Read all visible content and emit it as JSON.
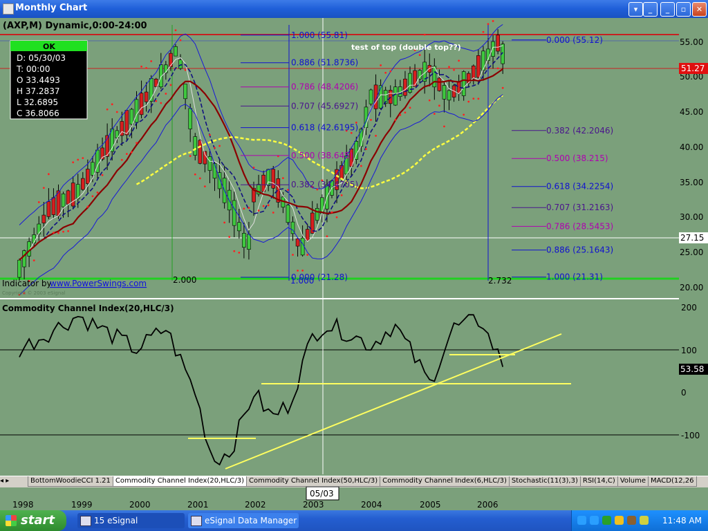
{
  "window": {
    "title": "Monthly Chart",
    "buttons": [
      "▾",
      "_",
      "▫",
      "✕"
    ]
  },
  "price_panel": {
    "symbol_label": "(AXP,M) Dynamic,0:00-24:00",
    "info_box": {
      "status": "OK",
      "lines": [
        "D: 05/30/03",
        "T: 00:00",
        "O 33.4493",
        "H 37.2837",
        "L 32.6895",
        "C 36.8066"
      ]
    },
    "indicator_credit": "Indicator by",
    "indicator_link": "www.PowerSwings.com",
    "copyright": "Copyright © 2003 eSignal",
    "annotation": "test of top (double top??)",
    "fib_left": [
      {
        "label": "1.000 (55.81)",
        "value": 55.81,
        "color": "#1010d0"
      },
      {
        "label": "0.886 (51.8736)",
        "value": 51.8736,
        "color": "#1010d0"
      },
      {
        "label": "0.786 (48.4206)",
        "value": 48.4206,
        "color": "#b000b0"
      },
      {
        "label": "0.707 (45.6927)",
        "value": 45.6927,
        "color": "#4a148c"
      },
      {
        "label": "0.618 (42.6195)",
        "value": 42.6195,
        "color": "#1010d0"
      },
      {
        "label": "0.500 (38.645)",
        "value": 38.645,
        "color": "#b000b0"
      },
      {
        "label": "0.382 (34.4705)",
        "value": 34.4705,
        "color": "#4a148c"
      },
      {
        "label": "0.000 (21.28)",
        "value": 21.28,
        "color": "#1010d0"
      }
    ],
    "fib_right": [
      {
        "label": "0.000 (55.12)",
        "value": 55.12,
        "color": "#1010d0"
      },
      {
        "label": "0.382 (42.2046)",
        "value": 42.2046,
        "color": "#4a148c"
      },
      {
        "label": "0.500 (38.215)",
        "value": 38.215,
        "color": "#b000b0"
      },
      {
        "label": "0.618 (34.2254)",
        "value": 34.2254,
        "color": "#1010d0"
      },
      {
        "label": "0.707 (31.2163)",
        "value": 31.2163,
        "color": "#4a148c"
      },
      {
        "label": "0.786 (28.5453)",
        "value": 28.5453,
        "color": "#b000b0"
      },
      {
        "label": "0.886 (25.1643)",
        "value": 25.1643,
        "color": "#1010d0"
      },
      {
        "label": "1.000 (21.31)",
        "value": 21.31,
        "color": "#1010d0"
      }
    ],
    "time_fib_labels": [
      "2.000",
      "1.000",
      "2.732"
    ],
    "price_axis_ticks": [
      "55.00",
      "50.00",
      "45.00",
      "40.00",
      "35.00",
      "30.00",
      "25.00",
      "20.00"
    ],
    "price_tick_values": [
      55,
      50,
      45,
      40,
      35,
      30,
      25,
      20
    ],
    "last_price_label": "51.27",
    "last_price_value": 51.27,
    "cursor_price_label": "27.15",
    "cursor_price_value": 27.15
  },
  "cci_panel": {
    "title": "Commodity Channel Index(20,HLC/3)",
    "axis_ticks": [
      "200",
      "100",
      "0",
      "-100"
    ],
    "tick_values": [
      200,
      100,
      0,
      -100
    ],
    "last_value_label": "53.58"
  },
  "x_axis": {
    "years": [
      "1998",
      "1999",
      "2000",
      "2001",
      "2002",
      "2003",
      "2004",
      "2005",
      "2006"
    ],
    "cursor_label": "05/03"
  },
  "tabs": [
    "BottomWoodieCCI 1.21",
    "Commodity Channel Index(20,HLC/3)",
    "Commodity Channel Index(50,HLC/3)",
    "Commodity Channel Index(6,HLC/3)",
    "Stochastic(11(3),3)",
    "RSI(14,C)",
    "Volume",
    "MACD(12,26"
  ],
  "taskbar": {
    "start": "start",
    "items": [
      "15 eSignal",
      "eSignal Data Manager"
    ],
    "clock": "11:48 AM"
  },
  "colors": {
    "bg": "#7ba07b",
    "up": "#3fc83f",
    "down": "#d61f1f",
    "ma_long": "#8b0000",
    "ma_yellow": "#ffff40",
    "band": "#1818d8",
    "cci": "#000000"
  },
  "chart_data": [
    {
      "type": "line",
      "title": "(AXP,M) Dynamic,0:00-24:00",
      "series": [
        {
          "name": "AXP",
          "x": [
            "1998",
            "1998.5",
            "1999",
            "1999.5",
            "2000",
            "2000.5",
            "2000.7",
            "2001",
            "2001.3",
            "2001.6",
            "2001.9",
            "2002",
            "2002.3",
            "2002.6",
            "2002.8",
            "2003",
            "2003.4",
            "2003.8",
            "2004",
            "2004.4",
            "2004.8",
            "2005",
            "2005.3",
            "2005.6",
            "2005.9",
            "2006",
            "2006.2",
            "2006.3"
          ],
          "values": [
            22.5,
            31,
            33.5,
            40,
            45,
            51,
            54,
            40,
            37,
            32,
            25,
            33,
            36,
            30,
            25,
            29,
            35,
            40,
            47,
            47,
            50,
            51,
            47,
            49,
            52,
            53,
            55,
            51.27
          ]
        }
      ],
      "ylim": [
        19,
        57.5
      ]
    },
    {
      "type": "line",
      "title": "Commodity Channel Index(20,HLC/3)",
      "series": [
        {
          "name": "CCI",
          "x": [
            "1998",
            "1998.5",
            "1999",
            "1999.5",
            "2000",
            "2000.5",
            "2001",
            "2001.3",
            "2001.6",
            "2002",
            "2002.3",
            "2002.6",
            "2003",
            "2003.2",
            "2003.6",
            "2004",
            "2004.4",
            "2005",
            "2005.4",
            "2005.9",
            "2006",
            "2006.3"
          ],
          "values": [
            100,
            140,
            180,
            140,
            100,
            150,
            0,
            -160,
            -140,
            0,
            -60,
            -30,
            130,
            160,
            140,
            110,
            160,
            20,
            150,
            170,
            130,
            53.58
          ]
        }
      ],
      "ylim": [
        -200,
        215
      ]
    }
  ]
}
